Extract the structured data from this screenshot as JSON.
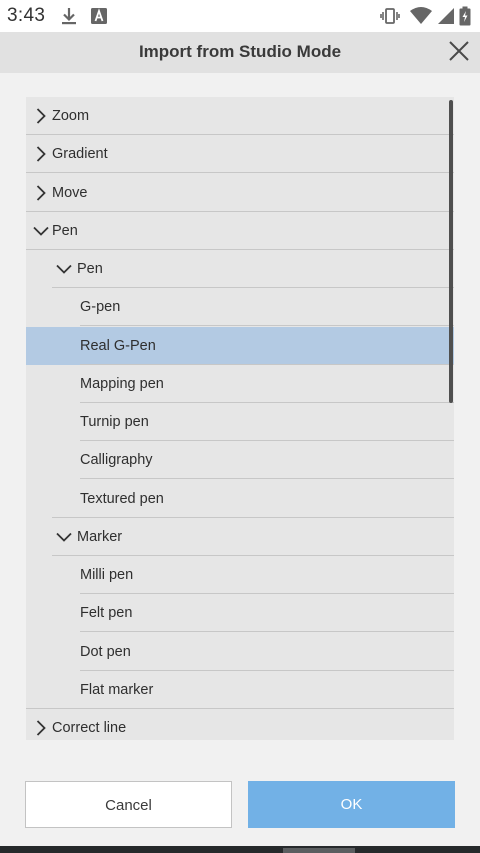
{
  "status_bar": {
    "time": "3:43",
    "icons": [
      "download-icon",
      "a-box-icon",
      "vibrate-icon",
      "wifi-icon",
      "signal-icon",
      "battery-icon"
    ]
  },
  "dialog": {
    "title": "Import from Studio Mode",
    "close_icon": "close-icon"
  },
  "tree": {
    "items": [
      {
        "label": "Zoom",
        "level": 0,
        "chevron": "right"
      },
      {
        "label": "Gradient",
        "level": 0,
        "chevron": "right"
      },
      {
        "label": "Move",
        "level": 0,
        "chevron": "right"
      },
      {
        "label": "Pen",
        "level": 0,
        "chevron": "down"
      },
      {
        "label": "Pen",
        "level": 1,
        "chevron": "down"
      },
      {
        "label": "G-pen",
        "level": 2,
        "chevron": "none"
      },
      {
        "label": "Real G-Pen",
        "level": 2,
        "chevron": "none",
        "selected": true
      },
      {
        "label": "Mapping pen",
        "level": 2,
        "chevron": "none"
      },
      {
        "label": "Turnip pen",
        "level": 2,
        "chevron": "none"
      },
      {
        "label": "Calligraphy",
        "level": 2,
        "chevron": "none"
      },
      {
        "label": "Textured pen",
        "level": 2,
        "chevron": "none"
      },
      {
        "label": "Marker",
        "level": 1,
        "chevron": "down"
      },
      {
        "label": "Milli pen",
        "level": 2,
        "chevron": "none"
      },
      {
        "label": "Felt pen",
        "level": 2,
        "chevron": "none"
      },
      {
        "label": "Dot pen",
        "level": 2,
        "chevron": "none"
      },
      {
        "label": "Flat marker",
        "level": 2,
        "chevron": "none"
      },
      {
        "label": "Correct line",
        "level": 0,
        "chevron": "right"
      }
    ]
  },
  "footer": {
    "cancel_label": "Cancel",
    "ok_label": "OK"
  },
  "colors": {
    "selected_row": "#b3cae3",
    "ok_button": "#72b1e6",
    "header_bg": "#e1e1e1",
    "list_bg": "#e6e6e6"
  }
}
